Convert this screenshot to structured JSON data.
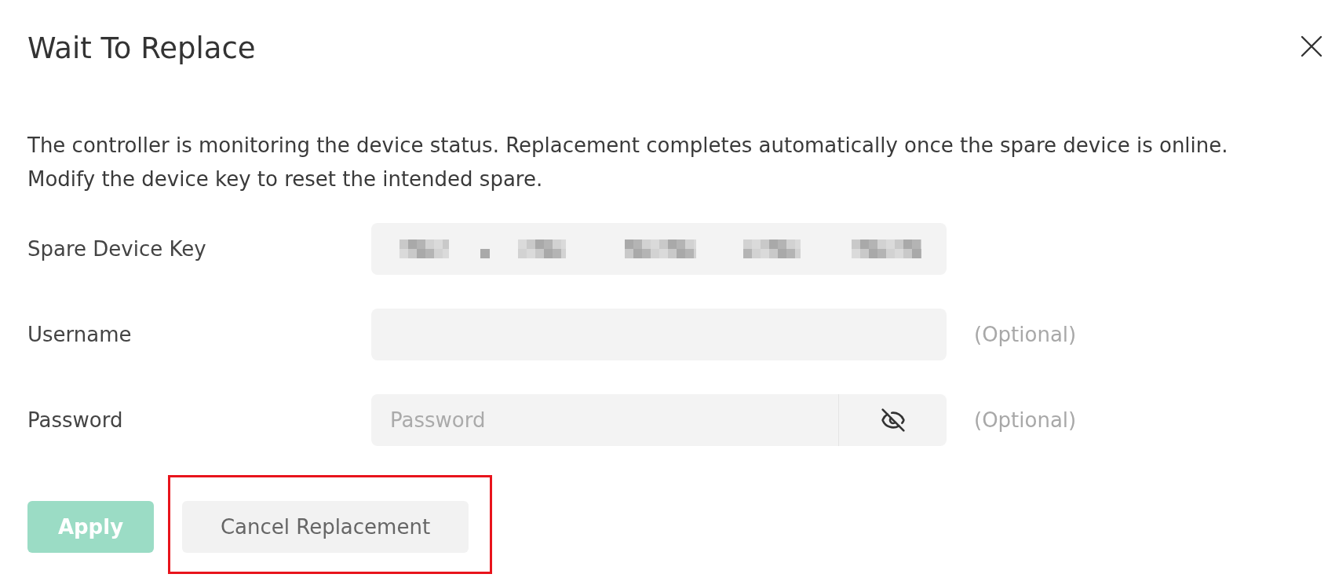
{
  "dialog": {
    "title": "Wait To Replace",
    "description": "The controller is monitoring the device status. Replacement completes automatically once the spare device is online. Modify the device key to reset the intended spare.",
    "fields": [
      {
        "kind": "key",
        "label": "Spare Device Key",
        "redacted": true
      },
      {
        "kind": "text",
        "label": "Username",
        "hint": "(Optional)"
      },
      {
        "kind": "password",
        "label": "Password",
        "placeholder": "Password",
        "show_password": false,
        "hint": "(Optional)"
      }
    ],
    "actions": [
      {
        "kind": "primary",
        "label": "Apply",
        "disabled": true,
        "highlighted": false
      },
      {
        "kind": "secondary",
        "label": "Cancel Replacement",
        "disabled": false,
        "highlighted": true
      }
    ]
  }
}
